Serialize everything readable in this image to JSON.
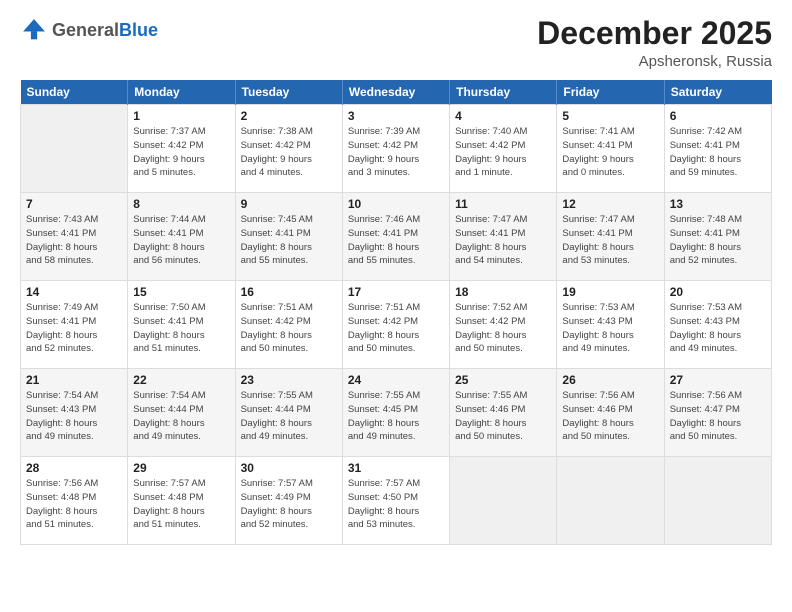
{
  "logo": {
    "general": "General",
    "blue": "Blue"
  },
  "header": {
    "month": "December 2025",
    "location": "Apsheronsk, Russia"
  },
  "days_of_week": [
    "Sunday",
    "Monday",
    "Tuesday",
    "Wednesday",
    "Thursday",
    "Friday",
    "Saturday"
  ],
  "weeks": [
    [
      {
        "day": "",
        "info": ""
      },
      {
        "day": "1",
        "info": "Sunrise: 7:37 AM\nSunset: 4:42 PM\nDaylight: 9 hours\nand 5 minutes."
      },
      {
        "day": "2",
        "info": "Sunrise: 7:38 AM\nSunset: 4:42 PM\nDaylight: 9 hours\nand 4 minutes."
      },
      {
        "day": "3",
        "info": "Sunrise: 7:39 AM\nSunset: 4:42 PM\nDaylight: 9 hours\nand 3 minutes."
      },
      {
        "day": "4",
        "info": "Sunrise: 7:40 AM\nSunset: 4:42 PM\nDaylight: 9 hours\nand 1 minute."
      },
      {
        "day": "5",
        "info": "Sunrise: 7:41 AM\nSunset: 4:41 PM\nDaylight: 9 hours\nand 0 minutes."
      },
      {
        "day": "6",
        "info": "Sunrise: 7:42 AM\nSunset: 4:41 PM\nDaylight: 8 hours\nand 59 minutes."
      }
    ],
    [
      {
        "day": "7",
        "info": "Sunrise: 7:43 AM\nSunset: 4:41 PM\nDaylight: 8 hours\nand 58 minutes."
      },
      {
        "day": "8",
        "info": "Sunrise: 7:44 AM\nSunset: 4:41 PM\nDaylight: 8 hours\nand 56 minutes."
      },
      {
        "day": "9",
        "info": "Sunrise: 7:45 AM\nSunset: 4:41 PM\nDaylight: 8 hours\nand 55 minutes."
      },
      {
        "day": "10",
        "info": "Sunrise: 7:46 AM\nSunset: 4:41 PM\nDaylight: 8 hours\nand 55 minutes."
      },
      {
        "day": "11",
        "info": "Sunrise: 7:47 AM\nSunset: 4:41 PM\nDaylight: 8 hours\nand 54 minutes."
      },
      {
        "day": "12",
        "info": "Sunrise: 7:47 AM\nSunset: 4:41 PM\nDaylight: 8 hours\nand 53 minutes."
      },
      {
        "day": "13",
        "info": "Sunrise: 7:48 AM\nSunset: 4:41 PM\nDaylight: 8 hours\nand 52 minutes."
      }
    ],
    [
      {
        "day": "14",
        "info": "Sunrise: 7:49 AM\nSunset: 4:41 PM\nDaylight: 8 hours\nand 52 minutes."
      },
      {
        "day": "15",
        "info": "Sunrise: 7:50 AM\nSunset: 4:41 PM\nDaylight: 8 hours\nand 51 minutes."
      },
      {
        "day": "16",
        "info": "Sunrise: 7:51 AM\nSunset: 4:42 PM\nDaylight: 8 hours\nand 50 minutes."
      },
      {
        "day": "17",
        "info": "Sunrise: 7:51 AM\nSunset: 4:42 PM\nDaylight: 8 hours\nand 50 minutes."
      },
      {
        "day": "18",
        "info": "Sunrise: 7:52 AM\nSunset: 4:42 PM\nDaylight: 8 hours\nand 50 minutes."
      },
      {
        "day": "19",
        "info": "Sunrise: 7:53 AM\nSunset: 4:43 PM\nDaylight: 8 hours\nand 49 minutes."
      },
      {
        "day": "20",
        "info": "Sunrise: 7:53 AM\nSunset: 4:43 PM\nDaylight: 8 hours\nand 49 minutes."
      }
    ],
    [
      {
        "day": "21",
        "info": "Sunrise: 7:54 AM\nSunset: 4:43 PM\nDaylight: 8 hours\nand 49 minutes."
      },
      {
        "day": "22",
        "info": "Sunrise: 7:54 AM\nSunset: 4:44 PM\nDaylight: 8 hours\nand 49 minutes."
      },
      {
        "day": "23",
        "info": "Sunrise: 7:55 AM\nSunset: 4:44 PM\nDaylight: 8 hours\nand 49 minutes."
      },
      {
        "day": "24",
        "info": "Sunrise: 7:55 AM\nSunset: 4:45 PM\nDaylight: 8 hours\nand 49 minutes."
      },
      {
        "day": "25",
        "info": "Sunrise: 7:55 AM\nSunset: 4:46 PM\nDaylight: 8 hours\nand 50 minutes."
      },
      {
        "day": "26",
        "info": "Sunrise: 7:56 AM\nSunset: 4:46 PM\nDaylight: 8 hours\nand 50 minutes."
      },
      {
        "day": "27",
        "info": "Sunrise: 7:56 AM\nSunset: 4:47 PM\nDaylight: 8 hours\nand 50 minutes."
      }
    ],
    [
      {
        "day": "28",
        "info": "Sunrise: 7:56 AM\nSunset: 4:48 PM\nDaylight: 8 hours\nand 51 minutes."
      },
      {
        "day": "29",
        "info": "Sunrise: 7:57 AM\nSunset: 4:48 PM\nDaylight: 8 hours\nand 51 minutes."
      },
      {
        "day": "30",
        "info": "Sunrise: 7:57 AM\nSunset: 4:49 PM\nDaylight: 8 hours\nand 52 minutes."
      },
      {
        "day": "31",
        "info": "Sunrise: 7:57 AM\nSunset: 4:50 PM\nDaylight: 8 hours\nand 53 minutes."
      },
      {
        "day": "",
        "info": ""
      },
      {
        "day": "",
        "info": ""
      },
      {
        "day": "",
        "info": ""
      }
    ]
  ]
}
